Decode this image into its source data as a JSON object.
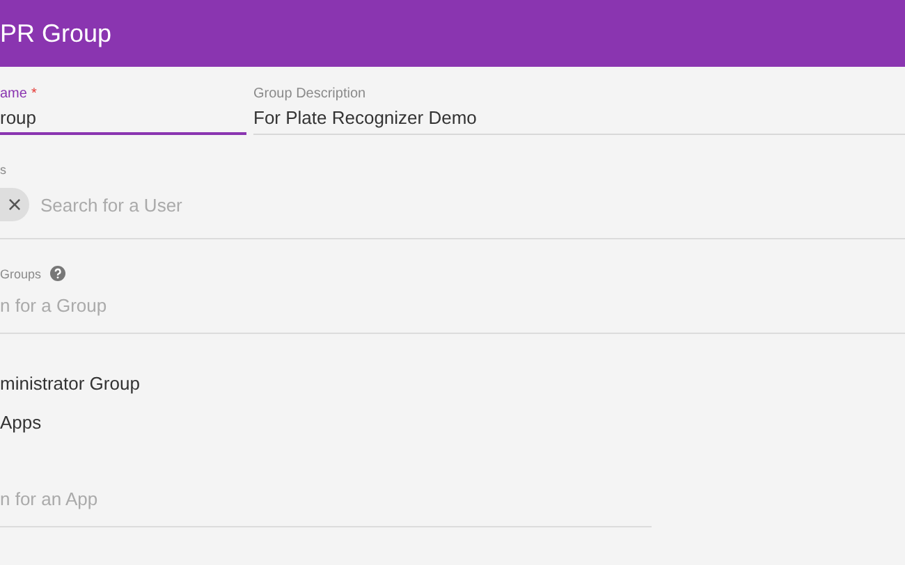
{
  "header": {
    "title": "PR Group"
  },
  "name_field": {
    "label": "ame",
    "required_mark": "*",
    "value": "roup",
    "focused": true
  },
  "description_field": {
    "label": "Group Description",
    "value": "For Plate Recognizer Demo"
  },
  "users_field": {
    "label": "s",
    "chip_remove": "×",
    "placeholder": "Search for a User"
  },
  "groups_field": {
    "label": "Groups",
    "placeholder": "n for a Group"
  },
  "items": [
    "ministrator Group",
    "Apps"
  ],
  "apps_field": {
    "placeholder": "n for an App"
  }
}
